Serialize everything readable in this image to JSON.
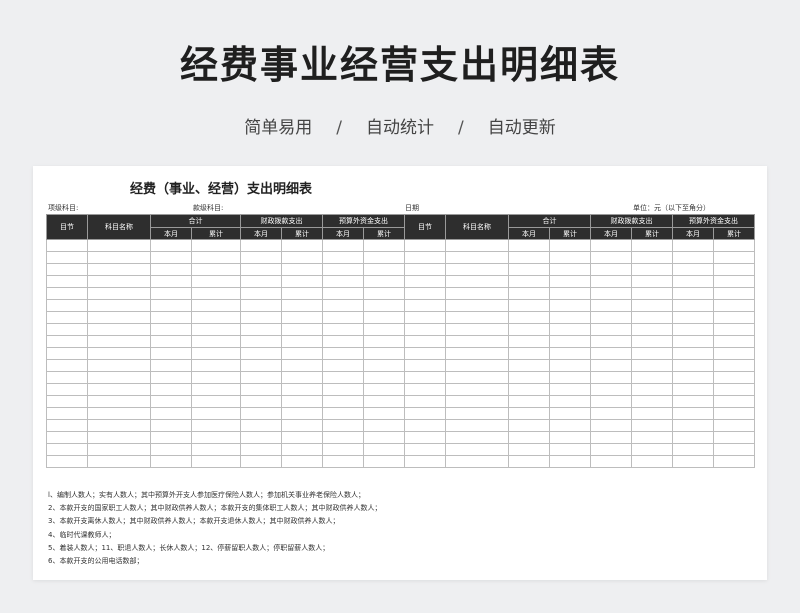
{
  "header": {
    "title": "经费事业经营支出明细表",
    "tags": [
      "简单易用",
      "自动统计",
      "自动更新"
    ],
    "separator": "/"
  },
  "sheet": {
    "title": "经费（事业、经营）支出明细表",
    "meta": {
      "item_level": "项级科目:",
      "section_level": "款级科目:",
      "date": "日期",
      "unit": "单位：元（以下至角分）"
    },
    "columns": {
      "section": "目节",
      "subject_name": "科目名称",
      "total": "合计",
      "fiscal": "财政拨款支出",
      "extra_budget": "预算外资金支出",
      "this_month": "本月",
      "cumulative": "累计"
    },
    "notes": [
      "l、编制人数人；实有人数人；其中预算外开支人参加医疗保险人数人；参加机关事业养老保险人数人；",
      "2、本款开支的国家职工人数人；其中财政供养人数人；本款开支的集体职工人数人；其中财政供养人数人；",
      "3、本款开支离休人数人；其中财政供养人数人；本款开支退休人数人；其中财政供养人数人；",
      "4、临时代课教师人；",
      "5、着装人数人；11、职退人数人；长休人数人；12、停薪留职人数人；停职留薪人数人；",
      "6、本款开支的公用电话数部；"
    ]
  }
}
